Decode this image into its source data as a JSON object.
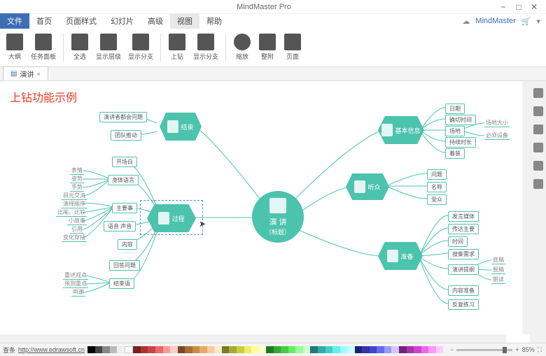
{
  "app": {
    "title": "MindMaster Pro",
    "brand": "MindMaster"
  },
  "window_controls": {
    "min": "−",
    "max": "□",
    "close": "✕"
  },
  "menu": {
    "file": "文件",
    "items": [
      "首页",
      "页面样式",
      "幻灯片",
      "高级",
      "视图",
      "帮助"
    ],
    "active_index": 4
  },
  "ribbon": {
    "groups": [
      [
        "大纲",
        "任务面板"
      ],
      [
        "全选",
        "显示层级",
        "显示分支"
      ],
      [
        "上钻",
        "显示分支"
      ],
      [
        "缩放",
        "整附",
        "页面"
      ]
    ]
  },
  "document_tab": {
    "name": "演讲",
    "close": "×"
  },
  "example_label": "上钻功能示例",
  "mindmap": {
    "center": {
      "line1": "演    讲",
      "line2": "（标题）"
    },
    "branches": {
      "end": {
        "label": "结束",
        "subs": [
          {
            "label": "演讲者都会问题",
            "leaves": []
          },
          {
            "label": "团队推动",
            "leaves": []
          }
        ]
      },
      "process": {
        "label": "过程",
        "subs": [
          {
            "label": "开场白",
            "leaves": []
          },
          {
            "label": "身体语言",
            "leaves": [
              "表情",
              "姿势",
              "手势",
              "目光交流"
            ]
          },
          {
            "label": "主要事",
            "leaves": [
              "演绎顺序",
              "比喻、比较",
              "小故事",
              "引用",
              "变化穿插"
            ]
          },
          {
            "label": "语音 声音",
            "leaves": []
          },
          {
            "label": "内容",
            "leaves": []
          },
          {
            "label": "回答问题",
            "leaves": []
          },
          {
            "label": "结束语",
            "leaves": [
              "重述观点",
              "预测重点",
              "鸣谢"
            ]
          }
        ]
      },
      "basic": {
        "label": "基本信息",
        "subs": [
          {
            "label": "日期",
            "leaves": []
          },
          {
            "label": "确切时间",
            "leaves": []
          },
          {
            "label": "场地",
            "leaves": [
              "场地大小",
              "必须设备"
            ]
          },
          {
            "label": "持续时长",
            "leaves": []
          },
          {
            "label": "着装",
            "leaves": []
          }
        ]
      },
      "audience": {
        "label": "听众",
        "subs": [
          {
            "label": "问题",
            "leaves": []
          },
          {
            "label": "名称",
            "leaves": []
          },
          {
            "label": "受众",
            "leaves": []
          }
        ]
      },
      "prepare": {
        "label": "准备",
        "subs": [
          {
            "label": "发言媒体",
            "leaves": []
          },
          {
            "label": "传达主要",
            "leaves": []
          },
          {
            "label": "时间",
            "leaves": []
          },
          {
            "label": "搜集需求",
            "leaves": []
          },
          {
            "label": "演讲提纲",
            "leaves": [
              "底稿",
              "脱稿",
              "朗读"
            ]
          },
          {
            "label": "内容准备",
            "leaves": []
          },
          {
            "label": "反复练习",
            "leaves": []
          }
        ]
      }
    }
  },
  "statusbar": {
    "url_label": "查条",
    "url": "http://www.edrawsoft.cn",
    "zoom": "85%"
  }
}
